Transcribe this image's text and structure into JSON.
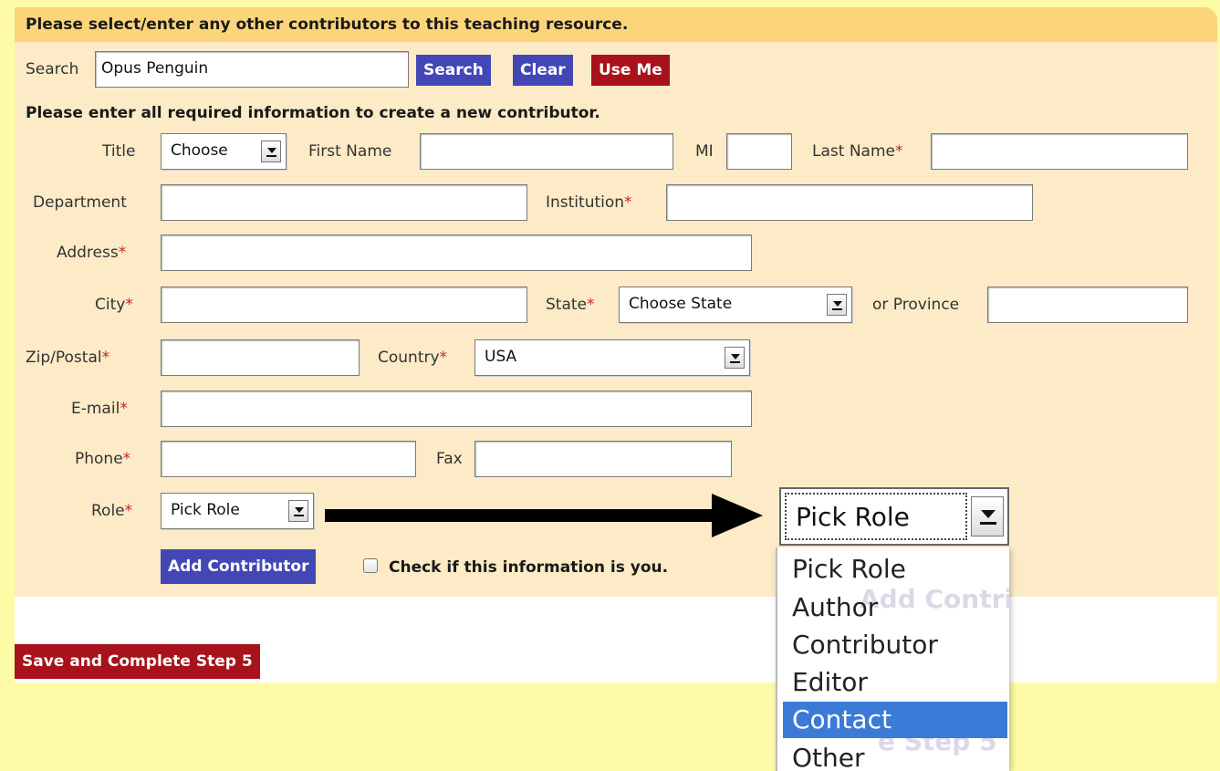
{
  "header": {
    "title": "Please select/enter any other contributors to this teaching resource."
  },
  "search": {
    "label": "Search",
    "value": "Opus Penguin",
    "search_button": "Search",
    "clear_button": "Clear",
    "use_me_button": "Use Me"
  },
  "instructions": "Please enter all required information to create a new contributor.",
  "required_marker": "*",
  "form": {
    "title": {
      "label": "Title",
      "selected": "Choose"
    },
    "first_name": {
      "label": "First Name",
      "value": ""
    },
    "mi": {
      "label": "MI",
      "value": ""
    },
    "last_name": {
      "label": "Last Name",
      "value": ""
    },
    "department": {
      "label": "Department",
      "value": ""
    },
    "institution": {
      "label": "Institution",
      "value": ""
    },
    "address": {
      "label": "Address",
      "value": ""
    },
    "city": {
      "label": "City",
      "value": ""
    },
    "state": {
      "label": "State",
      "selected": "Choose State"
    },
    "province": {
      "label": "or Province",
      "value": ""
    },
    "zip": {
      "label": "Zip/Postal",
      "value": ""
    },
    "country": {
      "label": "Country",
      "selected": "USA"
    },
    "email": {
      "label": "E-mail",
      "value": ""
    },
    "phone": {
      "label": "Phone",
      "value": ""
    },
    "fax": {
      "label": "Fax",
      "value": ""
    },
    "role": {
      "label": "Role",
      "selected": "Pick Role"
    }
  },
  "add_contributor_button": "Add Contributor",
  "check_is_you_label": "Check if this information is you.",
  "save_button": "Save and Complete Step 5",
  "zoom": {
    "selected": "Pick Role",
    "options": [
      "Pick Role",
      "Author",
      "Contributor",
      "Editor",
      "Contact",
      "Other"
    ],
    "highlighted": "Contact",
    "ghost_add": "Add Contribut",
    "ghost_step": "e Step 5"
  },
  "colors": {
    "page_background": "#fdfba6",
    "panel_background": "#fdebc7",
    "header_background": "#fcd57b",
    "button_blue": "#4347b5",
    "button_red": "#a8121a",
    "required_red": "#c0282c",
    "option_highlight": "#3c7ad8"
  }
}
